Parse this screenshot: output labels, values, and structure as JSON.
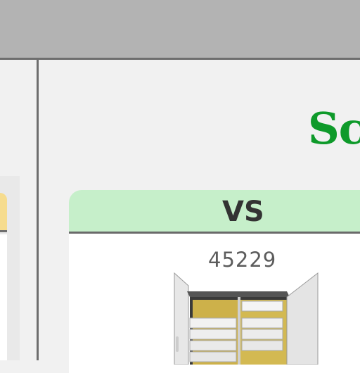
{
  "brand": {
    "text": "Sci"
  },
  "card": {
    "heading": "VS",
    "number": "45229",
    "image_icon": "cabinet-image",
    "header_color": "#c6efca"
  },
  "colors": {
    "top_bar": "#b3b3b3",
    "brand_green": "#0e9a2a",
    "left_card_header": "#f6dc8e",
    "divider": "#6e6e6e"
  }
}
